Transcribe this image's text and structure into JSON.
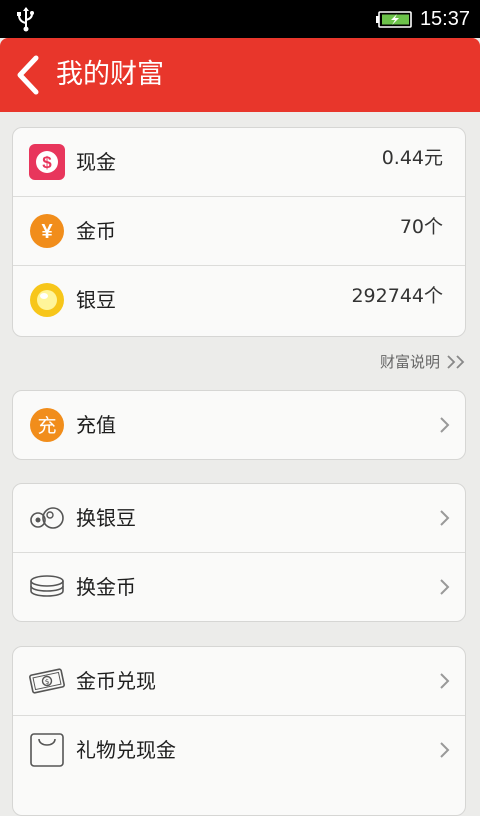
{
  "status_bar": {
    "time": "15:37"
  },
  "header": {
    "title": "我的财富"
  },
  "balances": [
    {
      "label": "现金",
      "value": "0.44元"
    },
    {
      "label": "金币",
      "value": "70个"
    },
    {
      "label": "银豆",
      "value": "292744个"
    }
  ],
  "wealth_link": {
    "label": "财富说明"
  },
  "recharge": {
    "label": "充值",
    "icon_text": "充"
  },
  "exchange": [
    {
      "label": "换银豆"
    },
    {
      "label": "换金币"
    }
  ],
  "redeem": [
    {
      "label": "金币兑现"
    },
    {
      "label": "礼物兑现金"
    }
  ],
  "colors": {
    "header_bg": "#e8362b",
    "cash_icon": "#e8365c",
    "coin_icon": "#f18d1b",
    "bean_icon": "#f7c61a"
  }
}
